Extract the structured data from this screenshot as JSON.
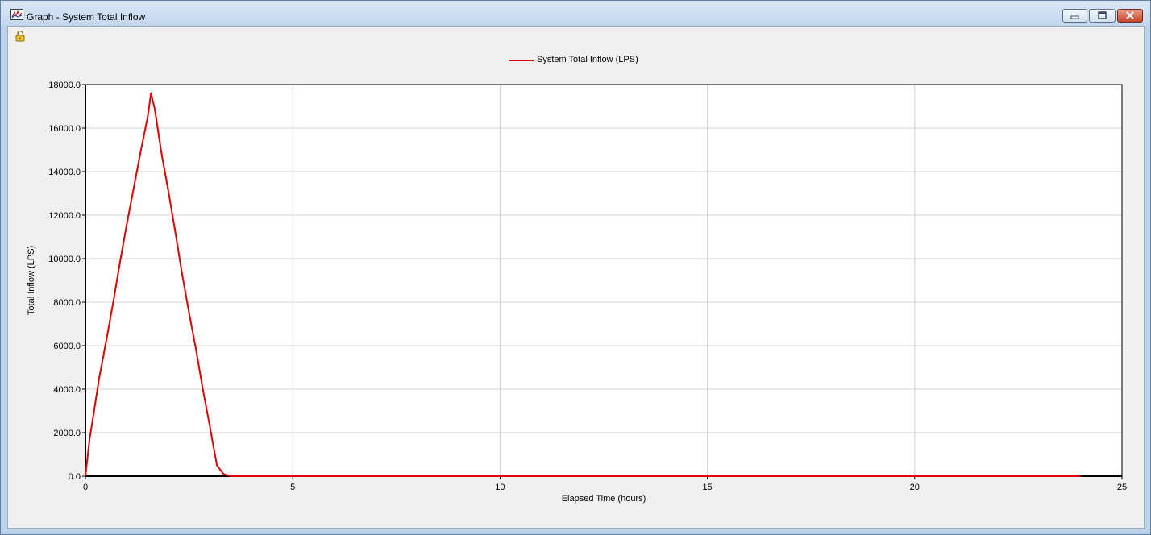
{
  "window": {
    "title": "Graph - System Total Inflow",
    "icons": [
      "graph-app-icon",
      "unlock-icon",
      "minimize-icon",
      "maximize-icon",
      "close-icon"
    ]
  },
  "chart_data": {
    "type": "line",
    "title": "",
    "xlabel": "Elapsed Time (hours)",
    "ylabel": "Total Inflow (LPS)",
    "xlim": [
      0,
      25
    ],
    "ylim": [
      0,
      18000
    ],
    "xticks": [
      "0",
      "5",
      "10",
      "15",
      "20",
      "25"
    ],
    "yticks": [
      "0.0",
      "2000.0",
      "4000.0",
      "6000.0",
      "8000.0",
      "10000.0",
      "12000.0",
      "14000.0",
      "16000.0",
      "18000.0"
    ],
    "grid": true,
    "legend_position": "top-center",
    "series": [
      {
        "name": "System Total Inflow (LPS)",
        "color": "#e00000",
        "x": [
          0,
          0.1,
          0.2,
          0.33,
          0.5,
          0.67,
          0.83,
          1.0,
          1.17,
          1.33,
          1.5,
          1.58,
          1.67,
          1.83,
          2.0,
          2.17,
          2.33,
          2.5,
          2.67,
          2.83,
          3.0,
          3.17,
          3.33,
          3.5,
          4,
          6,
          10,
          15,
          20,
          24
        ],
        "y": [
          0,
          1700,
          2900,
          4500,
          6200,
          8000,
          9800,
          11600,
          13300,
          14900,
          16500,
          17600,
          16900,
          14900,
          13100,
          11200,
          9300,
          7500,
          5800,
          4000,
          2300,
          500,
          100,
          0,
          0,
          0,
          0,
          0,
          0,
          0
        ]
      }
    ]
  }
}
